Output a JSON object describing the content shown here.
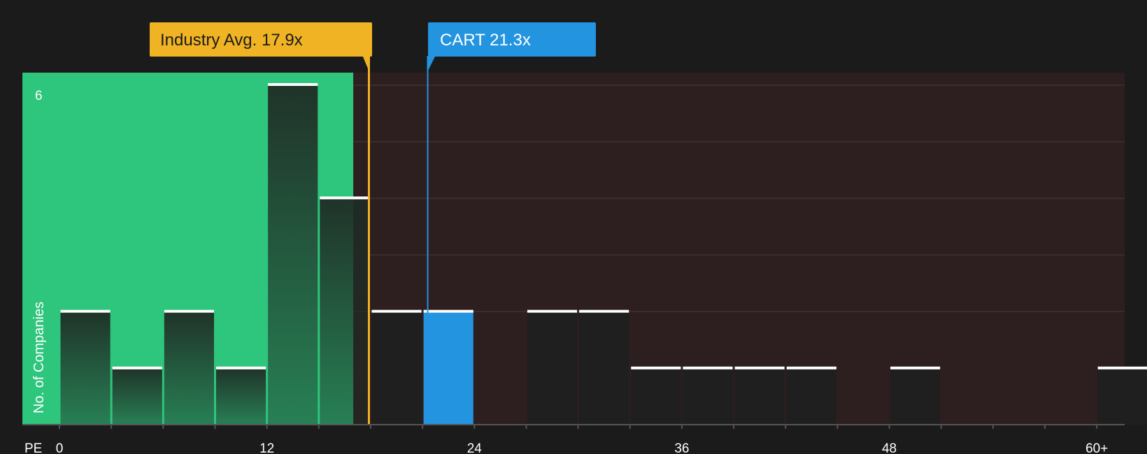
{
  "chart_data": {
    "type": "bar",
    "xlabel": "PE",
    "ylabel": "No. of Companies",
    "xlim": [
      0,
      61
    ],
    "ylim": [
      0,
      6.2
    ],
    "x_ticks": [
      {
        "value": 0,
        "label": "0"
      },
      {
        "value": 12,
        "label": "12"
      },
      {
        "value": 24,
        "label": "24"
      },
      {
        "value": 36,
        "label": "36"
      },
      {
        "value": 48,
        "label": "48"
      },
      {
        "value": 60,
        "label": "60+"
      }
    ],
    "y_ticks": [
      {
        "value": 6,
        "label": "6"
      }
    ],
    "bin_width": 3,
    "bins": [
      {
        "start": 0,
        "end": 3,
        "count": 2
      },
      {
        "start": 3,
        "end": 6,
        "count": 1
      },
      {
        "start": 6,
        "end": 9,
        "count": 2
      },
      {
        "start": 9,
        "end": 12,
        "count": 1
      },
      {
        "start": 12,
        "end": 15,
        "count": 6
      },
      {
        "start": 15,
        "end": 18,
        "count": 4
      },
      {
        "start": 18,
        "end": 21,
        "count": 2
      },
      {
        "start": 21,
        "end": 24,
        "count": 2,
        "highlight": true
      },
      {
        "start": 24,
        "end": 27,
        "count": 0
      },
      {
        "start": 27,
        "end": 30,
        "count": 2
      },
      {
        "start": 30,
        "end": 33,
        "count": 2
      },
      {
        "start": 33,
        "end": 36,
        "count": 1
      },
      {
        "start": 36,
        "end": 39,
        "count": 1
      },
      {
        "start": 39,
        "end": 42,
        "count": 1
      },
      {
        "start": 42,
        "end": 45,
        "count": 1
      },
      {
        "start": 45,
        "end": 48,
        "count": 0
      },
      {
        "start": 48,
        "end": 51,
        "count": 1
      },
      {
        "start": 51,
        "end": 54,
        "count": 0
      },
      {
        "start": 54,
        "end": 57,
        "count": 0
      },
      {
        "start": 57,
        "end": 60,
        "count": 0
      },
      {
        "start": 60,
        "end": 63,
        "count": 1
      }
    ],
    "undervalued_until": 17.0,
    "markers": [
      {
        "name": "industry-avg",
        "label": "Industry Avg. 17.9x",
        "value": 17.9,
        "color": "#f0b323",
        "text_color": "#1b1b1b"
      },
      {
        "name": "company",
        "label": "CART 21.3x",
        "value": 21.3,
        "color": "#2394e0",
        "text_color": "#ffffff"
      }
    ]
  },
  "colors": {
    "background": "#1b1b1b",
    "undervalued_zone": "#2ec57c",
    "overvalued_zone": "#2d1e1f",
    "bar_low": "#1f2a24",
    "bar_high": "#1f1f1f",
    "bar_highlight": "#2394e0",
    "bar_cap": "#ffffff",
    "gridline": "#4a3a3b",
    "axis": "#555555",
    "text": "#ffffff"
  }
}
